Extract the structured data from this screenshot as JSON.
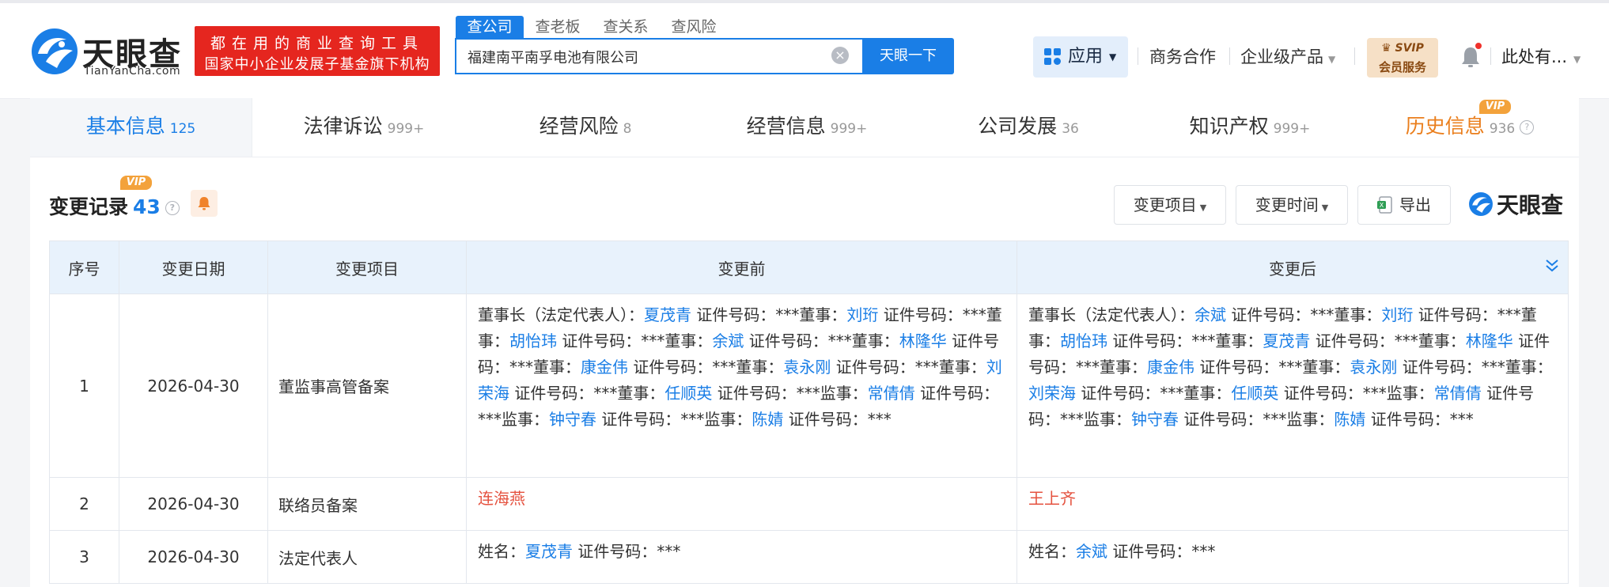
{
  "brand": {
    "name_cn": "天眼查",
    "name_en": "TianYanCha.com"
  },
  "promo": {
    "line1": "都在用的商业查询工具",
    "line2": "国家中小企业发展子基金旗下机构"
  },
  "search": {
    "tabs": [
      "查公司",
      "查老板",
      "查关系",
      "查风险"
    ],
    "query": "福建南平南孚电池有限公司",
    "button": "天眼一下"
  },
  "nav": {
    "apps": "应用",
    "business": "商务合作",
    "enterprise": "企业级产品",
    "svip_top": "SVIP",
    "svip_bottom": "会员服务",
    "user": "此处有..."
  },
  "main_tabs": [
    {
      "label": "基本信息",
      "count": "125"
    },
    {
      "label": "法律诉讼",
      "count": "999+"
    },
    {
      "label": "经营风险",
      "count": "8"
    },
    {
      "label": "经营信息",
      "count": "999+"
    },
    {
      "label": "公司发展",
      "count": "36"
    },
    {
      "label": "知识产权",
      "count": "999+"
    },
    {
      "label": "历史信息",
      "count": "936"
    }
  ],
  "vip_tag": "VIP",
  "section": {
    "title": "变更记录",
    "count": "43",
    "btn_item": "变更项目",
    "btn_time": "变更时间",
    "btn_export": "导出",
    "brand_small": "天眼查"
  },
  "table": {
    "headers": [
      "序号",
      "变更日期",
      "变更项目",
      "变更前",
      "变更后"
    ],
    "rows": [
      {
        "no": "1",
        "date": "2026-04-30",
        "item": "董监事高管备案",
        "before": [
          [
            "t",
            "董事长（法定代表人）："
          ],
          [
            "l",
            "夏茂青"
          ],
          [
            "t",
            " 证件号码：***董事："
          ],
          [
            "l",
            "刘珩"
          ],
          [
            "t",
            " 证件号码：***董事："
          ],
          [
            "l",
            "胡怡玮"
          ],
          [
            "t",
            " 证件号码：***董事："
          ],
          [
            "l",
            "余斌"
          ],
          [
            "t",
            " 证件号码：***董事："
          ],
          [
            "l",
            "林隆华"
          ],
          [
            "t",
            " 证件号码：***董事："
          ],
          [
            "l",
            "康金伟"
          ],
          [
            "t",
            " 证件号码：***董事："
          ],
          [
            "l",
            "袁永刚"
          ],
          [
            "t",
            " 证件号码：***董事："
          ],
          [
            "l",
            "刘荣海"
          ],
          [
            "t",
            " 证件号码：***董事："
          ],
          [
            "l",
            "任顺英"
          ],
          [
            "t",
            " 证件号码：***监事："
          ],
          [
            "l",
            "常倩倩"
          ],
          [
            "t",
            " 证件号码：***监事："
          ],
          [
            "l",
            "钟守春"
          ],
          [
            "t",
            " 证件号码：***监事："
          ],
          [
            "l",
            "陈婧"
          ],
          [
            "t",
            " 证件号码：***"
          ]
        ],
        "after": [
          [
            "t",
            "董事长（法定代表人）："
          ],
          [
            "l",
            "余斌"
          ],
          [
            "t",
            " 证件号码：***董事："
          ],
          [
            "l",
            "刘珩"
          ],
          [
            "t",
            " 证件号码：***董事："
          ],
          [
            "l",
            "胡怡玮"
          ],
          [
            "t",
            " 证件号码：***董事："
          ],
          [
            "l",
            "夏茂青"
          ],
          [
            "t",
            " 证件号码：***董事："
          ],
          [
            "l",
            "林隆华"
          ],
          [
            "t",
            " 证件号码：***董事："
          ],
          [
            "l",
            "康金伟"
          ],
          [
            "t",
            " 证件号码：***董事："
          ],
          [
            "l",
            "袁永刚"
          ],
          [
            "t",
            " 证件号码：***董事："
          ],
          [
            "l",
            "刘荣海"
          ],
          [
            "t",
            " 证件号码：***董事："
          ],
          [
            "l",
            "任顺英"
          ],
          [
            "t",
            " 证件号码：***监事："
          ],
          [
            "l",
            "常倩倩"
          ],
          [
            "t",
            " 证件号码：***监事："
          ],
          [
            "l",
            "钟守春"
          ],
          [
            "t",
            " 证件号码：***监事："
          ],
          [
            "l",
            "陈婧"
          ],
          [
            "t",
            " 证件号码：***"
          ]
        ]
      },
      {
        "no": "2",
        "date": "2026-04-30",
        "item": "联络员备案",
        "before": [
          [
            "r",
            "连海燕"
          ]
        ],
        "after": [
          [
            "r",
            "王上齐"
          ]
        ]
      },
      {
        "no": "3",
        "date": "2026-04-30",
        "item": "法定代表人",
        "before": [
          [
            "t",
            "姓名："
          ],
          [
            "l",
            "夏茂青"
          ],
          [
            "t",
            " 证件号码：***"
          ]
        ],
        "after": [
          [
            "t",
            "姓名："
          ],
          [
            "l",
            "余斌"
          ],
          [
            "t",
            " 证件号码：***"
          ]
        ]
      }
    ]
  },
  "colors": {
    "accent": "#1a7ee6",
    "red": "#e5261f",
    "history": "#ea7e1c",
    "vip": "#f3a23b"
  }
}
